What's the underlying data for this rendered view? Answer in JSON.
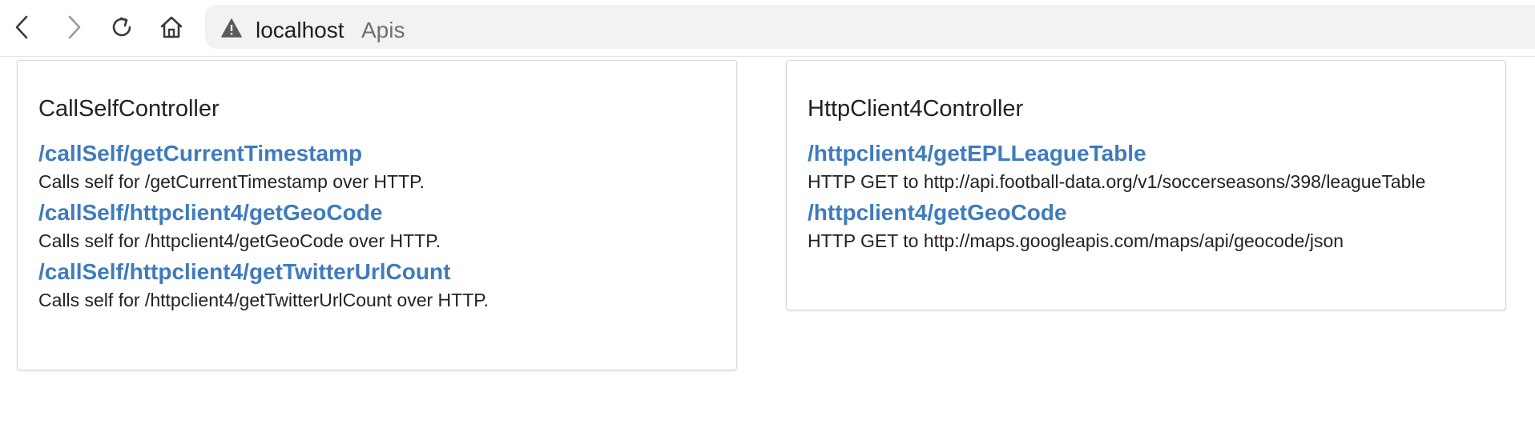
{
  "browser": {
    "address": {
      "host": "localhost",
      "page_title": "Apis"
    },
    "icons": {
      "back": "chevron-left-icon",
      "forward": "chevron-right-icon",
      "reload": "reload-icon",
      "home": "home-icon",
      "security": "warning-triangle-icon"
    }
  },
  "controllers": [
    {
      "name": "CallSelfController",
      "endpoints": [
        {
          "path": "/callSelf/getCurrentTimestamp",
          "description": "Calls self for /getCurrentTimestamp over HTTP."
        },
        {
          "path": "/callSelf/httpclient4/getGeoCode",
          "description": "Calls self for /httpclient4/getGeoCode over HTTP."
        },
        {
          "path": "/callSelf/httpclient4/getTwitterUrlCount",
          "description": "Calls self for /httpclient4/getTwitterUrlCount over HTTP."
        }
      ]
    },
    {
      "name": "HttpClient4Controller",
      "endpoints": [
        {
          "path": "/httpclient4/getEPLLeagueTable",
          "description": "HTTP GET to http://api.football-data.org/v1/soccerseasons/398/leagueTable"
        },
        {
          "path": "/httpclient4/getGeoCode",
          "description": "HTTP GET to http://maps.googleapis.com/maps/api/geocode/json"
        }
      ]
    }
  ],
  "colors": {
    "link": "#3f7bbd",
    "text": "#222222",
    "address_bar": "#f1f2f4",
    "muted": "#6f6f6f"
  }
}
